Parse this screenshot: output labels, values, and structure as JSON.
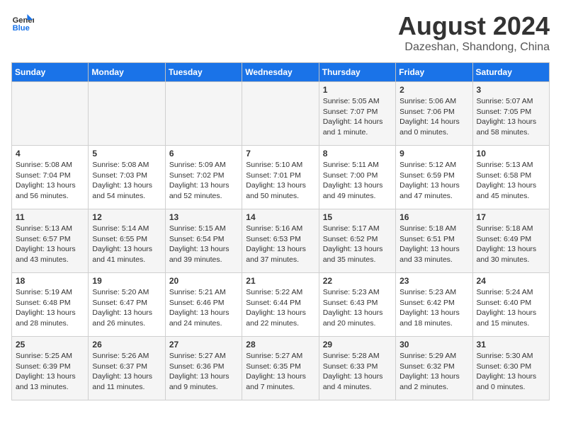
{
  "header": {
    "logo_line1": "General",
    "logo_line2": "Blue",
    "main_title": "August 2024",
    "subtitle": "Dazeshan, Shandong, China"
  },
  "weekdays": [
    "Sunday",
    "Monday",
    "Tuesday",
    "Wednesday",
    "Thursday",
    "Friday",
    "Saturday"
  ],
  "weeks": [
    [
      {
        "day": "",
        "info": ""
      },
      {
        "day": "",
        "info": ""
      },
      {
        "day": "",
        "info": ""
      },
      {
        "day": "",
        "info": ""
      },
      {
        "day": "1",
        "info": "Sunrise: 5:05 AM\nSunset: 7:07 PM\nDaylight: 14 hours\nand 1 minute."
      },
      {
        "day": "2",
        "info": "Sunrise: 5:06 AM\nSunset: 7:06 PM\nDaylight: 14 hours\nand 0 minutes."
      },
      {
        "day": "3",
        "info": "Sunrise: 5:07 AM\nSunset: 7:05 PM\nDaylight: 13 hours\nand 58 minutes."
      }
    ],
    [
      {
        "day": "4",
        "info": "Sunrise: 5:08 AM\nSunset: 7:04 PM\nDaylight: 13 hours\nand 56 minutes."
      },
      {
        "day": "5",
        "info": "Sunrise: 5:08 AM\nSunset: 7:03 PM\nDaylight: 13 hours\nand 54 minutes."
      },
      {
        "day": "6",
        "info": "Sunrise: 5:09 AM\nSunset: 7:02 PM\nDaylight: 13 hours\nand 52 minutes."
      },
      {
        "day": "7",
        "info": "Sunrise: 5:10 AM\nSunset: 7:01 PM\nDaylight: 13 hours\nand 50 minutes."
      },
      {
        "day": "8",
        "info": "Sunrise: 5:11 AM\nSunset: 7:00 PM\nDaylight: 13 hours\nand 49 minutes."
      },
      {
        "day": "9",
        "info": "Sunrise: 5:12 AM\nSunset: 6:59 PM\nDaylight: 13 hours\nand 47 minutes."
      },
      {
        "day": "10",
        "info": "Sunrise: 5:13 AM\nSunset: 6:58 PM\nDaylight: 13 hours\nand 45 minutes."
      }
    ],
    [
      {
        "day": "11",
        "info": "Sunrise: 5:13 AM\nSunset: 6:57 PM\nDaylight: 13 hours\nand 43 minutes."
      },
      {
        "day": "12",
        "info": "Sunrise: 5:14 AM\nSunset: 6:55 PM\nDaylight: 13 hours\nand 41 minutes."
      },
      {
        "day": "13",
        "info": "Sunrise: 5:15 AM\nSunset: 6:54 PM\nDaylight: 13 hours\nand 39 minutes."
      },
      {
        "day": "14",
        "info": "Sunrise: 5:16 AM\nSunset: 6:53 PM\nDaylight: 13 hours\nand 37 minutes."
      },
      {
        "day": "15",
        "info": "Sunrise: 5:17 AM\nSunset: 6:52 PM\nDaylight: 13 hours\nand 35 minutes."
      },
      {
        "day": "16",
        "info": "Sunrise: 5:18 AM\nSunset: 6:51 PM\nDaylight: 13 hours\nand 33 minutes."
      },
      {
        "day": "17",
        "info": "Sunrise: 5:18 AM\nSunset: 6:49 PM\nDaylight: 13 hours\nand 30 minutes."
      }
    ],
    [
      {
        "day": "18",
        "info": "Sunrise: 5:19 AM\nSunset: 6:48 PM\nDaylight: 13 hours\nand 28 minutes."
      },
      {
        "day": "19",
        "info": "Sunrise: 5:20 AM\nSunset: 6:47 PM\nDaylight: 13 hours\nand 26 minutes."
      },
      {
        "day": "20",
        "info": "Sunrise: 5:21 AM\nSunset: 6:46 PM\nDaylight: 13 hours\nand 24 minutes."
      },
      {
        "day": "21",
        "info": "Sunrise: 5:22 AM\nSunset: 6:44 PM\nDaylight: 13 hours\nand 22 minutes."
      },
      {
        "day": "22",
        "info": "Sunrise: 5:23 AM\nSunset: 6:43 PM\nDaylight: 13 hours\nand 20 minutes."
      },
      {
        "day": "23",
        "info": "Sunrise: 5:23 AM\nSunset: 6:42 PM\nDaylight: 13 hours\nand 18 minutes."
      },
      {
        "day": "24",
        "info": "Sunrise: 5:24 AM\nSunset: 6:40 PM\nDaylight: 13 hours\nand 15 minutes."
      }
    ],
    [
      {
        "day": "25",
        "info": "Sunrise: 5:25 AM\nSunset: 6:39 PM\nDaylight: 13 hours\nand 13 minutes."
      },
      {
        "day": "26",
        "info": "Sunrise: 5:26 AM\nSunset: 6:37 PM\nDaylight: 13 hours\nand 11 minutes."
      },
      {
        "day": "27",
        "info": "Sunrise: 5:27 AM\nSunset: 6:36 PM\nDaylight: 13 hours\nand 9 minutes."
      },
      {
        "day": "28",
        "info": "Sunrise: 5:27 AM\nSunset: 6:35 PM\nDaylight: 13 hours\nand 7 minutes."
      },
      {
        "day": "29",
        "info": "Sunrise: 5:28 AM\nSunset: 6:33 PM\nDaylight: 13 hours\nand 4 minutes."
      },
      {
        "day": "30",
        "info": "Sunrise: 5:29 AM\nSunset: 6:32 PM\nDaylight: 13 hours\nand 2 minutes."
      },
      {
        "day": "31",
        "info": "Sunrise: 5:30 AM\nSunset: 6:30 PM\nDaylight: 13 hours\nand 0 minutes."
      }
    ]
  ]
}
